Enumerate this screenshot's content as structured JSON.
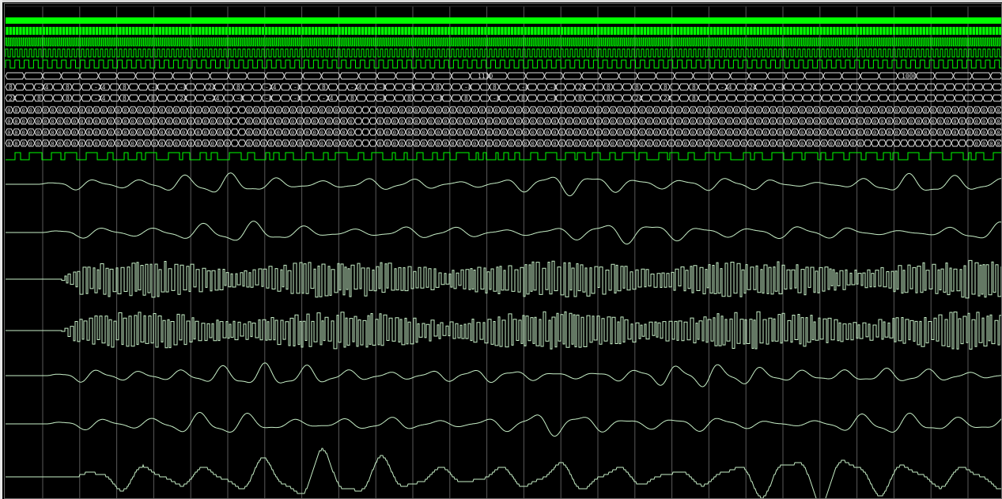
{
  "viewer": {
    "background": "#000000",
    "signal_color": "#00ff00",
    "analog_color": "#c8f0c8",
    "grid_color": "#5a5a5a"
  },
  "rows": {
    "bus_a_values": [
      "1110",
      "1000"
    ],
    "bus_b_values": [
      "8",
      "-24",
      "8",
      "-24",
      "8",
      "-8",
      "-8",
      "24",
      "8",
      "-24",
      "-8",
      "8",
      "-24",
      "-8",
      "-8",
      "8",
      "-8",
      "8",
      "-8",
      "-8",
      "24",
      "8",
      "8",
      "8",
      "8",
      "-24",
      "24",
      "-8"
    ],
    "bus_c_values": [
      "24",
      "8",
      "8",
      "-24",
      "8",
      "8",
      "24",
      "-24",
      "-8",
      "-8",
      "-8",
      "-24",
      "8",
      "-8",
      "8",
      "-8",
      "8",
      "-8",
      "8",
      "-8",
      "8",
      "8",
      "24",
      "24",
      "8"
    ],
    "digit_rows_value": "0"
  }
}
